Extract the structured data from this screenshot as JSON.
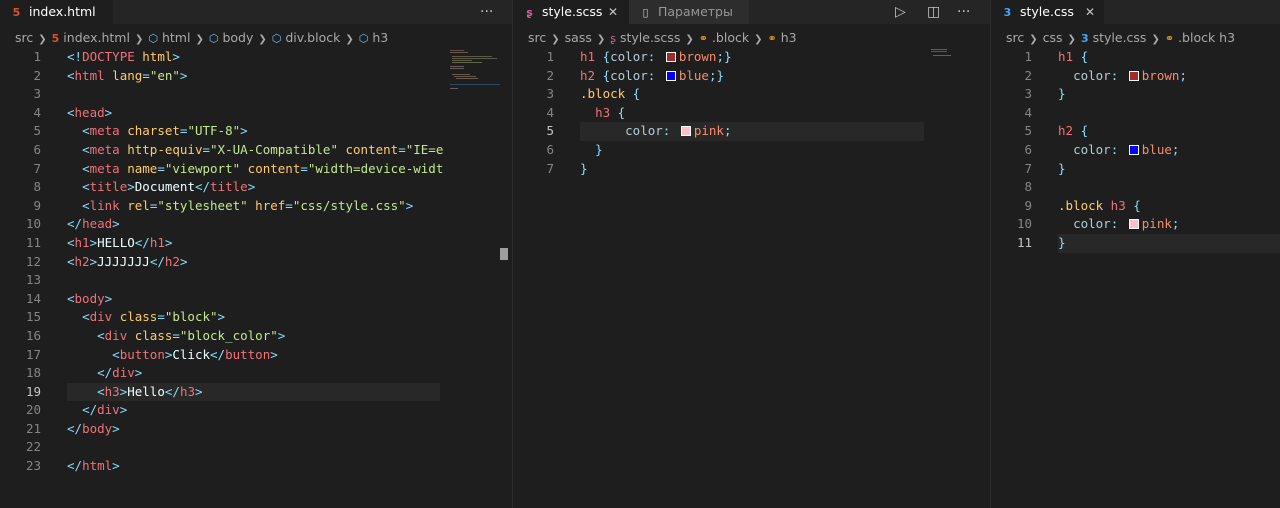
{
  "pane1": {
    "tab": {
      "label": "index.html",
      "icon": "5"
    },
    "more": "···",
    "breadcrumb": [
      "src",
      "index.html",
      "html",
      "body",
      "div.block",
      "h3"
    ],
    "current_line": "19",
    "lines": [
      {
        "n": "1",
        "segs": [
          [
            "h-punct",
            "<!"
          ],
          [
            "h-tag",
            "DOCTYPE"
          ],
          [
            "h-attr",
            " html"
          ],
          [
            "h-punct",
            ">"
          ]
        ]
      },
      {
        "n": "2",
        "segs": [
          [
            "h-punct",
            "<"
          ],
          [
            "h-tag",
            "html"
          ],
          [
            "h-attr",
            " lang"
          ],
          [
            "h-punct",
            "="
          ],
          [
            "h-str",
            "\"en\""
          ],
          [
            "h-punct",
            ">"
          ]
        ]
      },
      {
        "n": "3",
        "segs": []
      },
      {
        "n": "4",
        "segs": [
          [
            "h-punct",
            "<"
          ],
          [
            "h-tag",
            "head"
          ],
          [
            "h-punct",
            ">"
          ]
        ]
      },
      {
        "n": "5",
        "segs": [
          [
            "h-text",
            "  "
          ],
          [
            "h-punct",
            "<"
          ],
          [
            "h-tag",
            "meta"
          ],
          [
            "h-attr",
            " charset"
          ],
          [
            "h-punct",
            "="
          ],
          [
            "h-str",
            "\"UTF-8\""
          ],
          [
            "h-punct",
            ">"
          ]
        ]
      },
      {
        "n": "6",
        "segs": [
          [
            "h-text",
            "  "
          ],
          [
            "h-punct",
            "<"
          ],
          [
            "h-tag",
            "meta"
          ],
          [
            "h-attr",
            " http-equiv"
          ],
          [
            "h-punct",
            "="
          ],
          [
            "h-str",
            "\"X-UA-Compatible\""
          ],
          [
            "h-attr",
            " content"
          ],
          [
            "h-punct",
            "="
          ],
          [
            "h-str",
            "\"IE=e"
          ]
        ]
      },
      {
        "n": "7",
        "segs": [
          [
            "h-text",
            "  "
          ],
          [
            "h-punct",
            "<"
          ],
          [
            "h-tag",
            "meta"
          ],
          [
            "h-attr",
            " name"
          ],
          [
            "h-punct",
            "="
          ],
          [
            "h-str",
            "\"viewport\""
          ],
          [
            "h-attr",
            " content"
          ],
          [
            "h-punct",
            "="
          ],
          [
            "h-str",
            "\"width=device-widt"
          ]
        ]
      },
      {
        "n": "8",
        "segs": [
          [
            "h-text",
            "  "
          ],
          [
            "h-punct",
            "<"
          ],
          [
            "h-tag",
            "title"
          ],
          [
            "h-punct",
            ">"
          ],
          [
            "h-text",
            "Document"
          ],
          [
            "h-punct",
            "</"
          ],
          [
            "h-tag",
            "title"
          ],
          [
            "h-punct",
            ">"
          ]
        ]
      },
      {
        "n": "9",
        "segs": [
          [
            "h-text",
            "  "
          ],
          [
            "h-punct",
            "<"
          ],
          [
            "h-tag",
            "link"
          ],
          [
            "h-attr",
            " rel"
          ],
          [
            "h-punct",
            "="
          ],
          [
            "h-str",
            "\"stylesheet\""
          ],
          [
            "h-attr",
            " href"
          ],
          [
            "h-punct",
            "="
          ],
          [
            "h-str",
            "\"css/style.css\""
          ],
          [
            "h-punct",
            ">"
          ]
        ]
      },
      {
        "n": "10",
        "segs": [
          [
            "h-punct",
            "</"
          ],
          [
            "h-tag",
            "head"
          ],
          [
            "h-punct",
            ">"
          ]
        ]
      },
      {
        "n": "11",
        "segs": [
          [
            "h-punct",
            "<"
          ],
          [
            "h-tag",
            "h1"
          ],
          [
            "h-punct",
            ">"
          ],
          [
            "h-text",
            "HELLO"
          ],
          [
            "h-punct",
            "</"
          ],
          [
            "h-tag",
            "h1"
          ],
          [
            "h-punct",
            ">"
          ]
        ]
      },
      {
        "n": "12",
        "segs": [
          [
            "h-punct",
            "<"
          ],
          [
            "h-tag",
            "h2"
          ],
          [
            "h-punct",
            ">"
          ],
          [
            "h-text",
            "JJJJJJJ"
          ],
          [
            "h-punct",
            "</"
          ],
          [
            "h-tag",
            "h2"
          ],
          [
            "h-punct",
            ">"
          ]
        ]
      },
      {
        "n": "13",
        "segs": []
      },
      {
        "n": "14",
        "segs": [
          [
            "h-punct",
            "<"
          ],
          [
            "h-tag",
            "body"
          ],
          [
            "h-punct",
            ">"
          ]
        ]
      },
      {
        "n": "15",
        "segs": [
          [
            "h-text",
            "  "
          ],
          [
            "h-punct",
            "<"
          ],
          [
            "h-tag",
            "div"
          ],
          [
            "h-attr",
            " class"
          ],
          [
            "h-punct",
            "="
          ],
          [
            "h-str",
            "\"block\""
          ],
          [
            "h-punct",
            ">"
          ]
        ]
      },
      {
        "n": "16",
        "segs": [
          [
            "h-text",
            "    "
          ],
          [
            "h-punct",
            "<"
          ],
          [
            "h-tag",
            "div"
          ],
          [
            "h-attr",
            " class"
          ],
          [
            "h-punct",
            "="
          ],
          [
            "h-str",
            "\"block_color\""
          ],
          [
            "h-punct",
            ">"
          ]
        ]
      },
      {
        "n": "17",
        "segs": [
          [
            "h-text",
            "      "
          ],
          [
            "h-punct",
            "<"
          ],
          [
            "h-tag",
            "button"
          ],
          [
            "h-punct",
            ">"
          ],
          [
            "h-text",
            "Click"
          ],
          [
            "h-punct",
            "</"
          ],
          [
            "h-tag",
            "button"
          ],
          [
            "h-punct",
            ">"
          ]
        ]
      },
      {
        "n": "18",
        "segs": [
          [
            "h-text",
            "    "
          ],
          [
            "h-punct",
            "</"
          ],
          [
            "h-tag",
            "div"
          ],
          [
            "h-punct",
            ">"
          ]
        ]
      },
      {
        "n": "19",
        "segs": [
          [
            "h-text",
            "    "
          ],
          [
            "h-punct",
            "<"
          ],
          [
            "h-tag",
            "h3"
          ],
          [
            "h-punct",
            ">"
          ],
          [
            "h-text",
            "Hello"
          ],
          [
            "h-punct",
            "</"
          ],
          [
            "h-tag",
            "h3"
          ],
          [
            "h-punct",
            ">"
          ]
        ]
      },
      {
        "n": "20",
        "segs": [
          [
            "h-text",
            "  "
          ],
          [
            "h-punct",
            "</"
          ],
          [
            "h-tag",
            "div"
          ],
          [
            "h-punct",
            ">"
          ]
        ]
      },
      {
        "n": "21",
        "segs": [
          [
            "h-punct",
            "</"
          ],
          [
            "h-tag",
            "body"
          ],
          [
            "h-punct",
            ">"
          ]
        ]
      },
      {
        "n": "22",
        "segs": []
      },
      {
        "n": "23",
        "segs": [
          [
            "h-punct",
            "</"
          ],
          [
            "h-tag",
            "html"
          ],
          [
            "h-punct",
            ">"
          ]
        ]
      }
    ]
  },
  "pane2": {
    "tabs": [
      {
        "label": "style.scss",
        "icon": "sass",
        "active": true
      },
      {
        "label": "Параметры",
        "icon": "file",
        "active": false
      }
    ],
    "close": "✕",
    "more": "···",
    "breadcrumb": [
      "src",
      "sass",
      "style.scss",
      ".block",
      "h3"
    ],
    "current_line": "5",
    "lines": [
      {
        "n": "1",
        "segs": [
          [
            "c-sel",
            "h1"
          ],
          [
            "c-brace",
            " {"
          ],
          [
            "c-prop",
            "color"
          ],
          [
            "c-brace",
            ": "
          ],
          [
            "swatch",
            "#a52a2a"
          ],
          [
            "c-val",
            "brown"
          ],
          [
            "c-brace",
            ";}"
          ]
        ]
      },
      {
        "n": "2",
        "segs": [
          [
            "c-sel",
            "h2"
          ],
          [
            "c-brace",
            " {"
          ],
          [
            "c-prop",
            "color"
          ],
          [
            "c-brace",
            ": "
          ],
          [
            "swatch",
            "#0000ff"
          ],
          [
            "c-val",
            "blue"
          ],
          [
            "c-brace",
            ";}"
          ]
        ]
      },
      {
        "n": "3",
        "segs": [
          [
            "c-cls",
            ".block"
          ],
          [
            "c-brace",
            " {"
          ]
        ]
      },
      {
        "n": "4",
        "segs": [
          [
            "h-text",
            "  "
          ],
          [
            "c-sel",
            "h3"
          ],
          [
            "c-brace",
            " {"
          ]
        ]
      },
      {
        "n": "5",
        "segs": [
          [
            "h-text",
            "      "
          ],
          [
            "c-prop",
            "color"
          ],
          [
            "c-brace",
            ": "
          ],
          [
            "swatch",
            "#ffc0cb"
          ],
          [
            "c-val",
            "pink"
          ],
          [
            "c-brace",
            ";"
          ]
        ]
      },
      {
        "n": "6",
        "segs": [
          [
            "h-text",
            "  "
          ],
          [
            "c-brace",
            "}"
          ]
        ]
      },
      {
        "n": "7",
        "segs": [
          [
            "c-brace",
            "}"
          ]
        ]
      }
    ]
  },
  "pane3": {
    "tab": {
      "label": "style.css",
      "icon": "css"
    },
    "close": "✕",
    "breadcrumb": [
      "src",
      "css",
      "style.css",
      ".block h3"
    ],
    "current_line": "11",
    "lines": [
      {
        "n": "1",
        "segs": [
          [
            "c-sel",
            "h1"
          ],
          [
            "c-brace",
            " {"
          ]
        ]
      },
      {
        "n": "2",
        "segs": [
          [
            "h-text",
            "  "
          ],
          [
            "c-prop",
            "color"
          ],
          [
            "c-brace",
            ": "
          ],
          [
            "swatch",
            "#a52a2a"
          ],
          [
            "c-val",
            "brown"
          ],
          [
            "c-brace",
            ";"
          ]
        ]
      },
      {
        "n": "3",
        "segs": [
          [
            "c-brace",
            "}"
          ]
        ]
      },
      {
        "n": "4",
        "segs": []
      },
      {
        "n": "5",
        "segs": [
          [
            "c-sel",
            "h2"
          ],
          [
            "c-brace",
            " {"
          ]
        ]
      },
      {
        "n": "6",
        "segs": [
          [
            "h-text",
            "  "
          ],
          [
            "c-prop",
            "color"
          ],
          [
            "c-brace",
            ": "
          ],
          [
            "swatch",
            "#0000ff"
          ],
          [
            "c-val",
            "blue"
          ],
          [
            "c-brace",
            ";"
          ]
        ]
      },
      {
        "n": "7",
        "segs": [
          [
            "c-brace",
            "}"
          ]
        ]
      },
      {
        "n": "8",
        "segs": []
      },
      {
        "n": "9",
        "segs": [
          [
            "c-cls",
            ".block"
          ],
          [
            "c-sel",
            " h3"
          ],
          [
            "c-brace",
            " {"
          ]
        ]
      },
      {
        "n": "10",
        "segs": [
          [
            "h-text",
            "  "
          ],
          [
            "c-prop",
            "color"
          ],
          [
            "c-brace",
            ": "
          ],
          [
            "swatch",
            "#ffc0cb"
          ],
          [
            "c-val",
            "pink"
          ],
          [
            "c-brace",
            ";"
          ]
        ]
      },
      {
        "n": "11",
        "segs": [
          [
            "c-brace",
            "}"
          ]
        ]
      }
    ]
  },
  "icons": {
    "run": "run-icon",
    "split": "split-editor-icon",
    "more": "more-actions-icon"
  },
  "colors": {
    "editor_bg": "#1e1e1e",
    "tabbar_bg": "#252526",
    "current_line_bg": "#282828",
    "html_icon": "#e44d26",
    "sass_icon": "#cd6799",
    "css_icon": "#42a5f5"
  }
}
